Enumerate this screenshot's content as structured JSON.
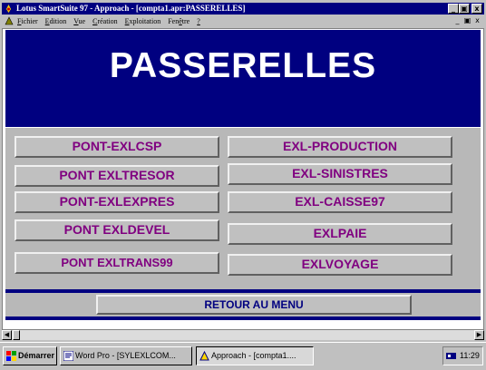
{
  "window": {
    "title": "Lotus SmartSuite 97  -  Approach - [compta1.apr:PASSERELLES]",
    "controls": [
      "_",
      "̵",
      "x"
    ]
  },
  "menu": {
    "items": [
      {
        "underline": "F",
        "rest": "ichier"
      },
      {
        "underline": "E",
        "rest": "dition"
      },
      {
        "underline": "V",
        "rest": "ue"
      },
      {
        "underline": "C",
        "rest": "réation"
      },
      {
        "underline": "E",
        "rest": "xploitation"
      },
      {
        "pre": "Fen",
        "underline": "ê",
        "rest": "tre"
      },
      {
        "underline": "?",
        "rest": ""
      }
    ]
  },
  "banner": {
    "title": "PASSERELLES"
  },
  "buttons": {
    "left": [
      "PONT-EXLCSP",
      "PONT EXLTRESOR",
      "PONT-EXLEXPRES",
      "PONT EXLDEVEL",
      "PONT EXLTRANS99"
    ],
    "right": [
      "EXL-PRODUCTION",
      "EXL-SINISTRES",
      "EXL-CAISSE97",
      "EXLPAIE",
      "EXLVOYAGE"
    ],
    "return": "RETOUR AU MENU"
  },
  "taskbar": {
    "start": "Démarrer",
    "tasks": [
      "Word Pro - [SYLEXLCOM...",
      "Approach - [compta1...."
    ],
    "clock": "11:29"
  },
  "colors": {
    "banner": "#000080",
    "button_text": "#800080",
    "panel": "#b8b8b8"
  }
}
